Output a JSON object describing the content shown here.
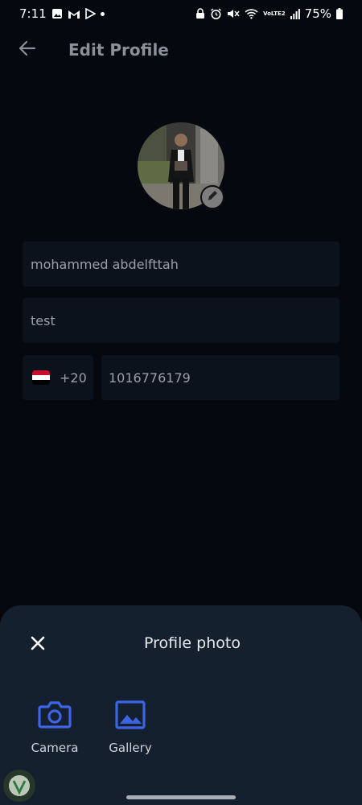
{
  "status_bar": {
    "time": "7:11",
    "battery": "75%",
    "left_icons": [
      "photo-icon",
      "gmail-icon",
      "play-store-icon"
    ],
    "right_icons": [
      "lock-icon",
      "alarm-icon",
      "mute-icon",
      "wifi-icon",
      "volte-icon",
      "signal-icon",
      "battery-icon"
    ],
    "volte_label": "VoLTE2"
  },
  "header": {
    "title": "Edit Profile",
    "back_icon": "arrow-left-icon"
  },
  "profile": {
    "avatar_icon": "profile-photo",
    "edit_icon": "pencil-icon"
  },
  "form": {
    "full_name": "mohammed abdelfttah",
    "last_name": "test",
    "country_code": "+20",
    "country_flag": "egypt-flag-icon",
    "phone": "1016776179"
  },
  "sheet": {
    "title": "Profile photo",
    "close_icon": "close-icon",
    "options": [
      {
        "label": "Camera",
        "icon": "camera-icon"
      },
      {
        "label": "Gallery",
        "icon": "image-icon"
      }
    ]
  },
  "colors": {
    "background": "#05080f",
    "field_bg": "#0c121b",
    "sheet_bg": "#15202e",
    "accent": "#3d63e6",
    "title": "#8a9099"
  }
}
